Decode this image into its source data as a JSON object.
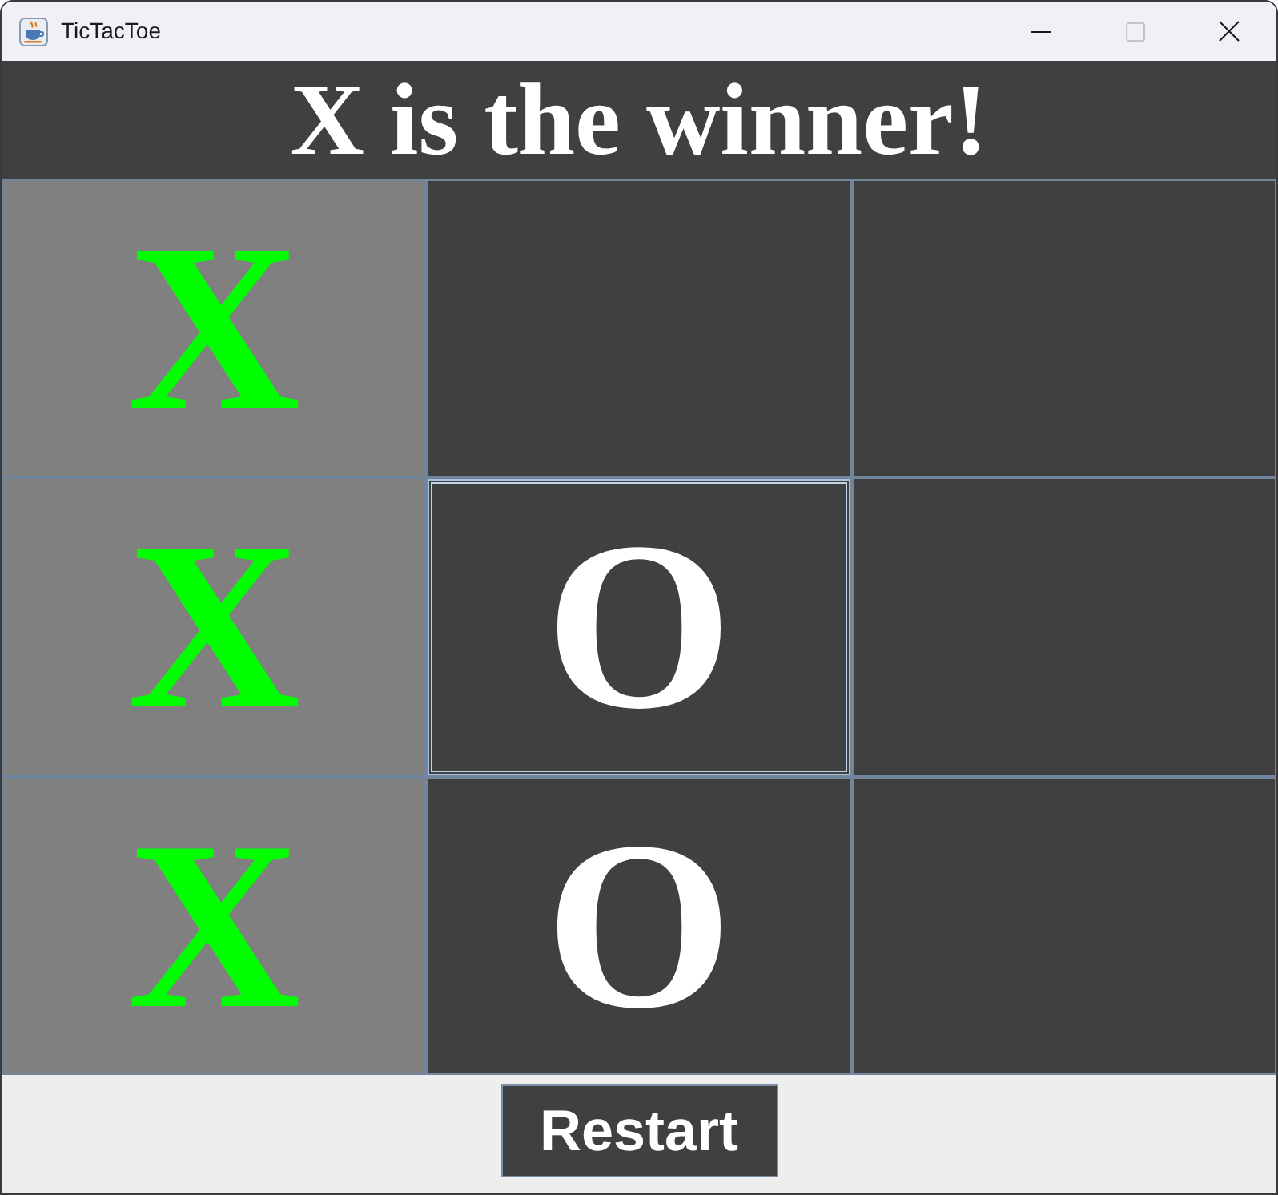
{
  "window": {
    "title": "TicTacToe",
    "controls": [
      {
        "kind": "minimize",
        "disabled": false
      },
      {
        "kind": "maximize",
        "disabled": true
      },
      {
        "kind": "close",
        "disabled": false
      }
    ]
  },
  "status": "X is the winner!",
  "board": [
    {
      "mark": "X",
      "winning": true,
      "focused": false
    },
    {
      "winning": false,
      "focused": false
    },
    {
      "winning": false,
      "focused": false
    },
    {
      "mark": "X",
      "winning": true,
      "focused": false
    },
    {
      "mark": "O",
      "winning": false,
      "focused": true
    },
    {
      "winning": false,
      "focused": false
    },
    {
      "mark": "X",
      "winning": true,
      "focused": false
    },
    {
      "mark": "O",
      "winning": false,
      "focused": false
    },
    {
      "winning": false,
      "focused": false
    }
  ],
  "restart_button": {
    "label": "Restart"
  }
}
